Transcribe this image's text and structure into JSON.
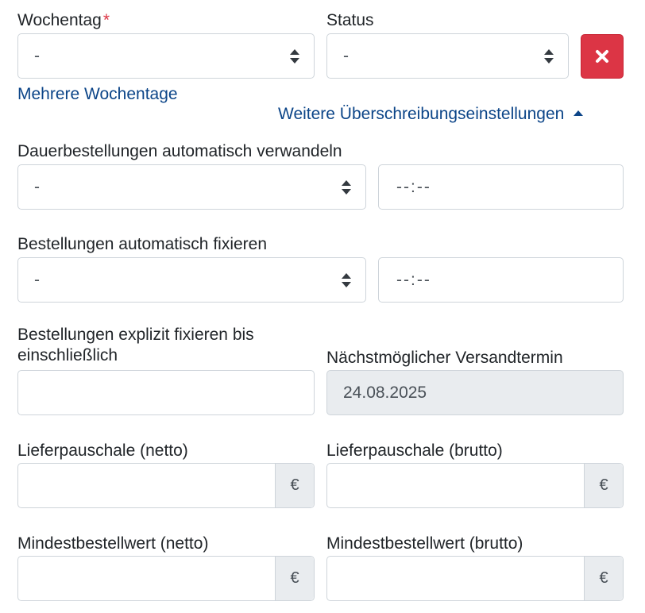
{
  "wochentag": {
    "label": "Wochentag",
    "required_mark": "*",
    "value": "-"
  },
  "status": {
    "label": "Status",
    "value": "-"
  },
  "delete_icon": "close-icon",
  "links": {
    "mehrere_wochentage": "Mehrere Wochentage",
    "weitere_einstellungen": "Weitere Überschreibungseinstellungen",
    "weitere_einstellungen_icon": "caret-up-icon"
  },
  "dauer": {
    "label": "Dauerbestellungen automatisch verwandeln",
    "select_value": "-",
    "time_value": "--:--"
  },
  "fixieren": {
    "label": "Bestellungen automatisch fixieren",
    "select_value": "-",
    "time_value": "--:--"
  },
  "explizit": {
    "label": "Bestellungen explizit fixieren bis einschließlich",
    "value": ""
  },
  "versand": {
    "label": "Nächstmöglicher Versandtermin",
    "value": "24.08.2025"
  },
  "lieferpauschale_netto": {
    "label": "Lieferpauschale (netto)",
    "value": "",
    "currency": "€"
  },
  "lieferpauschale_brutto": {
    "label": "Lieferpauschale (brutto)",
    "value": "",
    "currency": "€"
  },
  "mindest_netto": {
    "label": "Mindestbestellwert (netto)",
    "value": "",
    "currency": "€"
  },
  "mindest_brutto": {
    "label": "Mindestbestellwert (brutto)",
    "value": "",
    "currency": "€"
  }
}
